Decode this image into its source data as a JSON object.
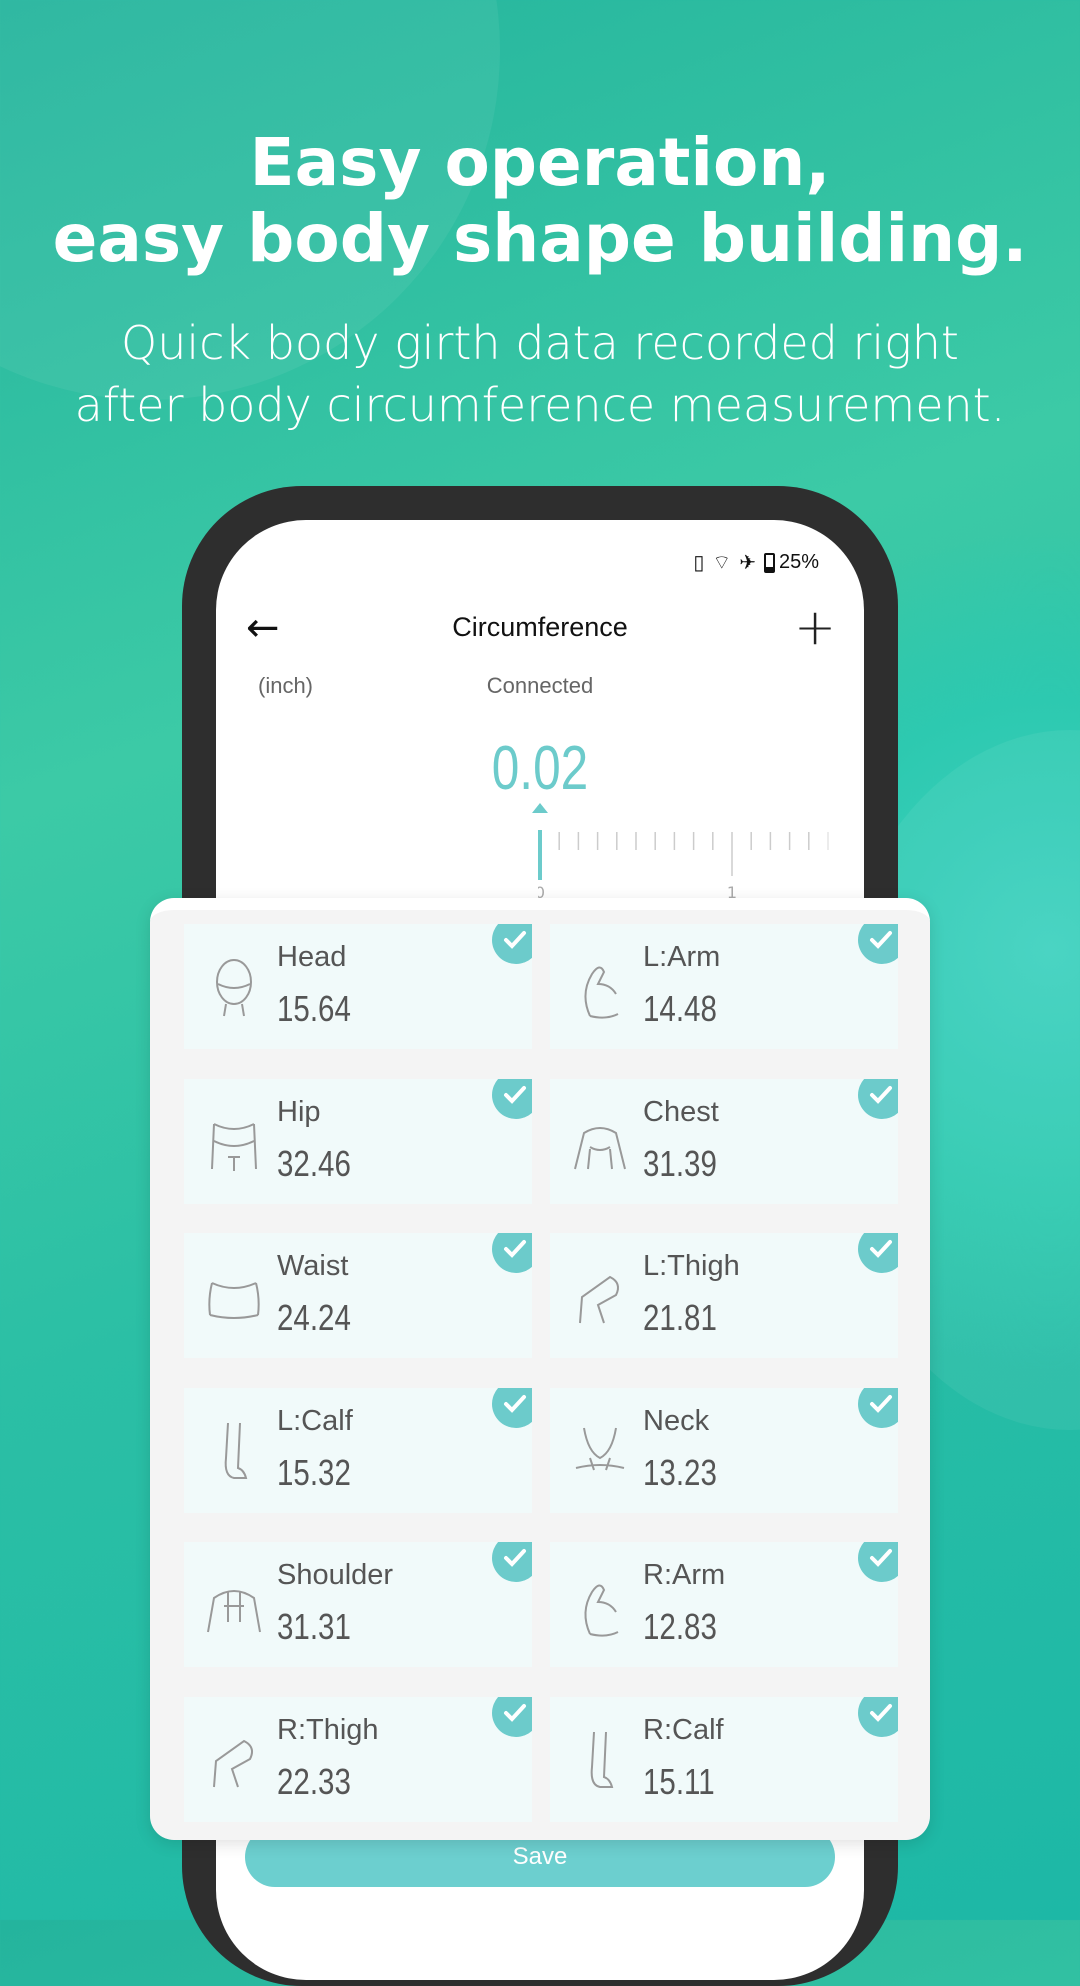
{
  "promo": {
    "title_line1": "Easy operation,",
    "title_line2": "easy body shape building.",
    "subtitle_line1": "Quick body girth data recorded right",
    "subtitle_line2": "after body circumference measurement."
  },
  "status": {
    "battery": "25%",
    "icons": [
      "vibrate-icon",
      "wifi-icon",
      "airplane-icon",
      "battery-icon"
    ]
  },
  "header": {
    "title": "Circumference",
    "back_icon": "arrow-left-icon",
    "add_icon": "plus-icon"
  },
  "unit": "(inch)",
  "connection": "Connected",
  "reading": "0.02",
  "ruler": {
    "labels": [
      "0",
      "1"
    ]
  },
  "accent": "#6ccbcb",
  "items": [
    {
      "name": "Head",
      "value": "15.64",
      "icon": "head-icon",
      "checked": true
    },
    {
      "name": "L:Arm",
      "value": "14.48",
      "icon": "arm-icon",
      "checked": true
    },
    {
      "name": "Hip",
      "value": "32.46",
      "icon": "hip-icon",
      "checked": true
    },
    {
      "name": "Chest",
      "value": "31.39",
      "icon": "chest-icon",
      "checked": true
    },
    {
      "name": "Waist",
      "value": "24.24",
      "icon": "waist-icon",
      "checked": true
    },
    {
      "name": "L:Thigh",
      "value": "21.81",
      "icon": "thigh-icon",
      "checked": true
    },
    {
      "name": "L:Calf",
      "value": "15.32",
      "icon": "calf-icon",
      "checked": true
    },
    {
      "name": "Neck",
      "value": "13.23",
      "icon": "neck-icon",
      "checked": true
    },
    {
      "name": "Shoulder",
      "value": "31.31",
      "icon": "shoulder-icon",
      "checked": true
    },
    {
      "name": "R:Arm",
      "value": "12.83",
      "icon": "arm-icon",
      "checked": true
    },
    {
      "name": "R:Thigh",
      "value": "22.33",
      "icon": "thigh-icon",
      "checked": true
    },
    {
      "name": "R:Calf",
      "value": "15.11",
      "icon": "calf-icon",
      "checked": true
    }
  ],
  "save_label": "Save"
}
